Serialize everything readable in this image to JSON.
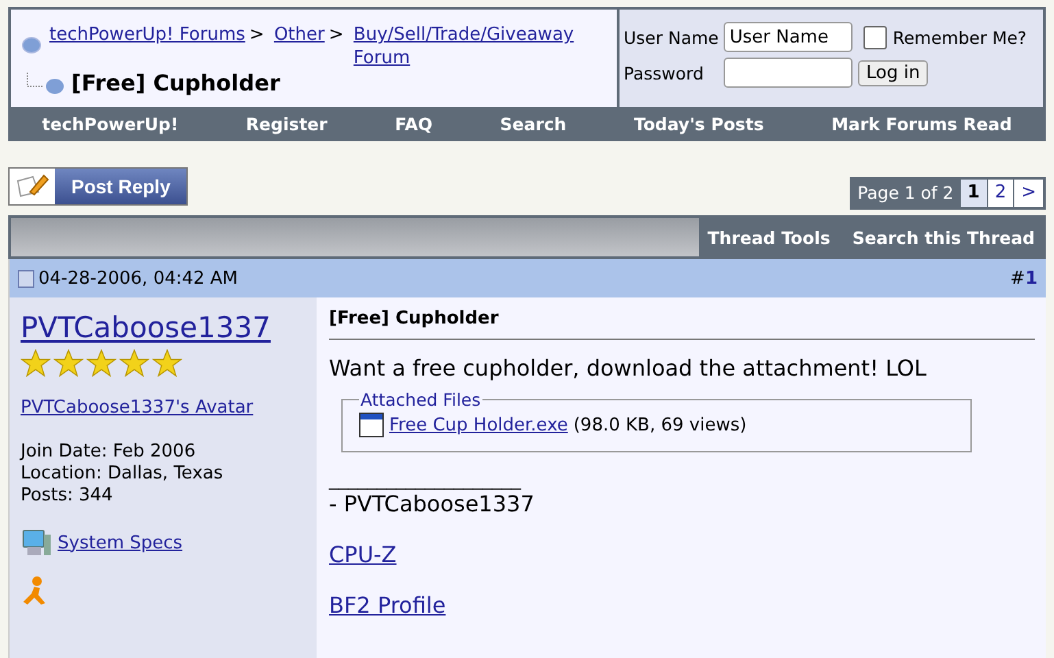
{
  "breadcrumb": {
    "links": [
      "techPowerUp! Forums",
      "Other",
      "Buy/Sell/Trade/Giveaway Forum"
    ],
    "separator": ">",
    "title": "[Free] Cupholder"
  },
  "login": {
    "username_label": "User Name",
    "username_value": "User Name",
    "remember_label": "Remember Me?",
    "remember_checked": false,
    "password_label": "Password",
    "button": "Log in"
  },
  "nav": [
    "techPowerUp!",
    "Register",
    "FAQ",
    "Search",
    "Today's Posts",
    "Mark Forums Read"
  ],
  "post_reply_button": "Post Reply",
  "pagination": {
    "label": "Page 1 of 2",
    "pages": [
      {
        "label": "1",
        "selected": true
      },
      {
        "label": "2",
        "selected": false
      }
    ],
    "next": ">"
  },
  "thread_tools": [
    "Thread Tools",
    "Search this Thread"
  ],
  "post": {
    "date": "04-28-2006, 04:42 AM",
    "number_prefix": "#",
    "number": "1",
    "author": "PVTCaboose1337",
    "stars": 5,
    "avatar_link": "PVTCaboose1337's Avatar",
    "details": [
      "Join Date: Feb 2006",
      "Location: Dallas, Texas",
      "Posts: 344"
    ],
    "system_specs": "System Specs",
    "title": "[Free] Cupholder",
    "message": "Want a free cupholder, download the attachment! LOL",
    "attachments_legend": "Attached Files",
    "file_name": "Free Cup Holder.exe",
    "file_info": "(98.0 KB, 69 views)",
    "signature_rule": "____________________",
    "signature": "- PVTCaboose1337",
    "links": [
      "CPU-Z",
      "BF2 Profile"
    ]
  }
}
